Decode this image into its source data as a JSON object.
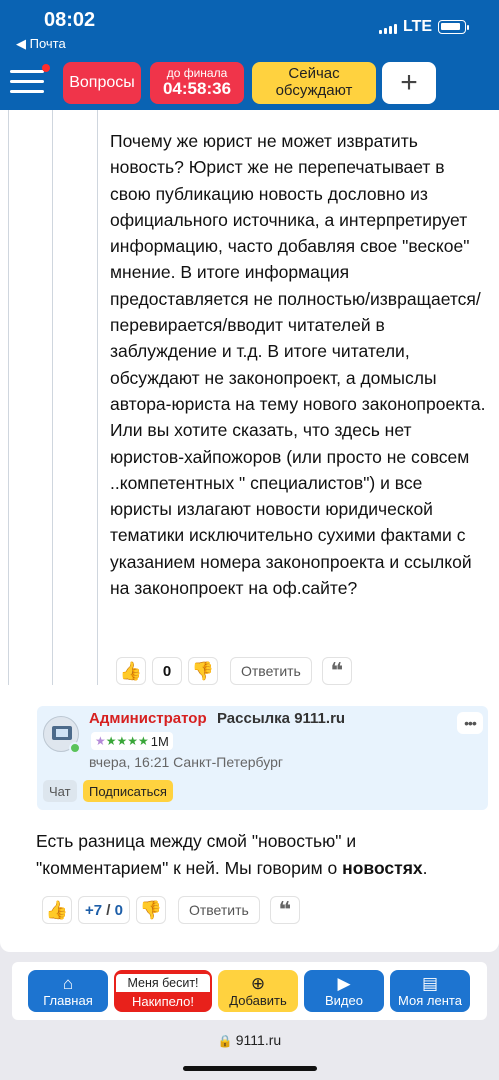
{
  "status": {
    "time": "08:02",
    "back_label": "◀ Почта",
    "network": "LTE"
  },
  "nav": {
    "questions_label": "Вопросы",
    "timer_caption": "до финала",
    "timer_value": "04:58:36",
    "discussing_line1": "Сейчас",
    "discussing_line2": "обсуждают",
    "plus_label": "+"
  },
  "quote_comment": {
    "text": "Почему же юрист не может извратить новость? Юрист же не перепечатывает в свою публикацию новость дословно из официального источника, а интерпретирует информацию, часто добавляя свое \"веское\" мнение. В итоге информация предоставляется не полностью/извращается/перевирается/вводит читателей в заблуждение и т.д. В итоге читатели, обсуждают не законопроект, а домыслы автора-юриста на тему нового законопроекта.",
    "text2": "Или вы хотите сказать, что здесь нет юристов-хайпожоров (или просто не совсем ..компетентных \" специалистов\") и все юристы излагают новости юридической тематики исключительно сухими фактами с указанием номера законопроекта и ссылкой на законопроект на оф.сайте?",
    "rating": "0",
    "reply_label": "Ответить",
    "quote_icon": "❝"
  },
  "author": {
    "role": "Администратор",
    "name": "Рассылка 9111.ru",
    "stars_purple": "★",
    "stars_green": "★★★★",
    "rank": "1M",
    "meta": "вчера, 16:21  Санкт-Петербург",
    "chat_label": "Чат",
    "subscribe_label": "Подписаться",
    "more_label": "•••"
  },
  "reply_comment": {
    "text_before": "Есть разница между смой \"новостью\" и \"комментарием\" к ней. Мы говорим о ",
    "text_bold": "новостях",
    "text_after": ".",
    "rating_plus": "+7",
    "rating_sep": "/",
    "rating_minus": "0",
    "reply_label": "Ответить",
    "quote_icon": "❝"
  },
  "tabbar": {
    "home_label": "Главная",
    "annoy_top": "Меня бесит!",
    "annoy_bottom": "Накипело!",
    "add_label": "Добавить",
    "video_label": "Видео",
    "feed_label": "Моя лента"
  },
  "browser": {
    "url": "9111.ru"
  },
  "colors": {
    "brand_blue": "#0a63b3",
    "red": "#f0344a",
    "yellow": "#ffd23f"
  }
}
